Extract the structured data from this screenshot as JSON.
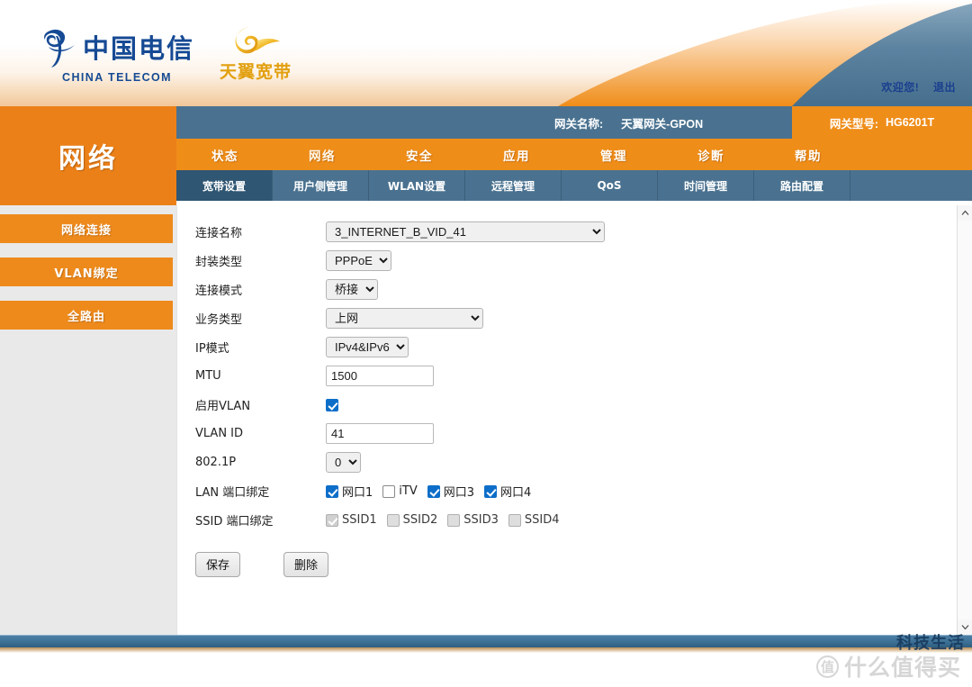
{
  "banner": {
    "logo_cn": "中国电信",
    "logo_en": "CHINA TELECOM",
    "sub_logo": "天翼宽带",
    "welcome": "欢迎您!",
    "logout": "退出"
  },
  "gateway": {
    "name_label": "网关名称:",
    "name_value": "天翼网关-GPON",
    "model_label": "网关型号:",
    "model_value": "HG6201T"
  },
  "side_title": "网络",
  "nav_main": [
    {
      "label": "状态",
      "active": false
    },
    {
      "label": "网络",
      "active": true
    },
    {
      "label": "安全",
      "active": false
    },
    {
      "label": "应用",
      "active": false
    },
    {
      "label": "管理",
      "active": false
    },
    {
      "label": "诊断",
      "active": false
    },
    {
      "label": "帮助",
      "active": false
    }
  ],
  "nav_sub": [
    {
      "label": "宽带设置",
      "active": true
    },
    {
      "label": "用户侧管理",
      "active": false
    },
    {
      "label": "WLAN设置",
      "active": false
    },
    {
      "label": "远程管理",
      "active": false
    },
    {
      "label": "QoS",
      "active": false
    },
    {
      "label": "时间管理",
      "active": false
    },
    {
      "label": "路由配置",
      "active": false
    }
  ],
  "sidebar": [
    {
      "label": "网络连接"
    },
    {
      "label": "VLAN绑定"
    },
    {
      "label": "全路由"
    }
  ],
  "form": {
    "connection_name": {
      "label": "连接名称",
      "value": "3_INTERNET_B_VID_41"
    },
    "encapsulation": {
      "label": "封装类型",
      "value": "PPPoE"
    },
    "connection_mode": {
      "label": "连接模式",
      "value": "桥接"
    },
    "service_type": {
      "label": "业务类型",
      "value": "上网"
    },
    "ip_mode": {
      "label": "IP模式",
      "value": "IPv4&IPv6"
    },
    "mtu": {
      "label": "MTU",
      "value": "1500"
    },
    "enable_vlan": {
      "label": "启用VLAN",
      "checked": true
    },
    "vlan_id": {
      "label": "VLAN ID",
      "value": "41"
    },
    "dot1p": {
      "label": "802.1P",
      "value": "0"
    },
    "lan_binding": {
      "label": "LAN 端口绑定",
      "items": [
        {
          "label": "网口1",
          "checked": true,
          "disabled": false
        },
        {
          "label": "iTV",
          "checked": false,
          "disabled": false
        },
        {
          "label": "网口3",
          "checked": true,
          "disabled": false
        },
        {
          "label": "网口4",
          "checked": true,
          "disabled": false
        }
      ]
    },
    "ssid_binding": {
      "label": "SSID 端口绑定",
      "items": [
        {
          "label": "SSID1",
          "checked": true,
          "disabled": true
        },
        {
          "label": "SSID2",
          "checked": false,
          "disabled": true
        },
        {
          "label": "SSID3",
          "checked": false,
          "disabled": true
        },
        {
          "label": "SSID4",
          "checked": false,
          "disabled": true
        }
      ]
    },
    "save_button": "保存",
    "delete_button": "删除"
  },
  "watermark": {
    "top_text": "科技生活",
    "badge": "值",
    "text": "什么值得买"
  },
  "colors": {
    "orange": "#ef8d19",
    "blue_gray": "#4a7290",
    "logo_blue": "#164a94",
    "logo_gold": "#e2a010",
    "checkbox_blue": "#0d6ec9"
  }
}
